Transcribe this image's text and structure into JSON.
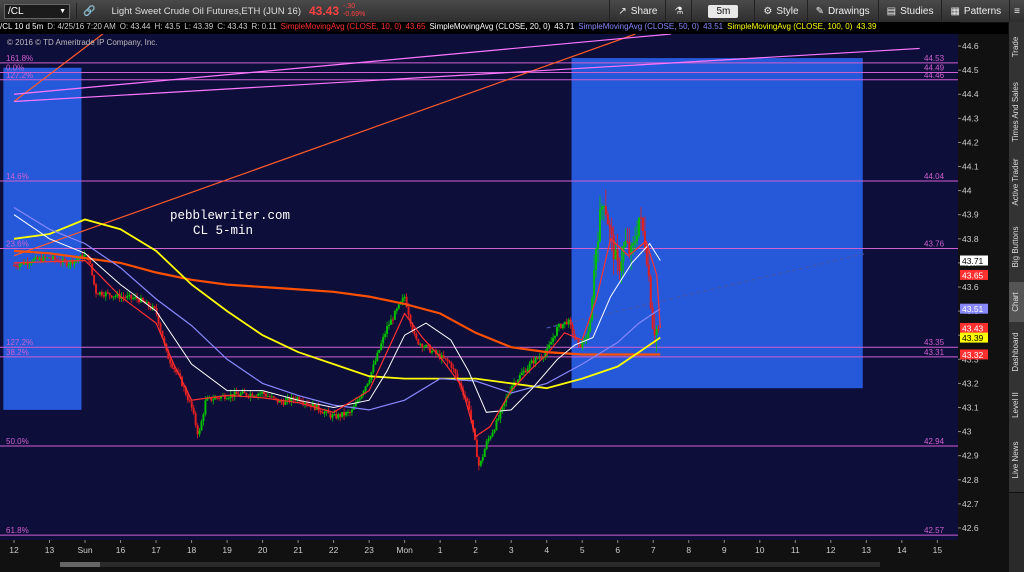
{
  "toolbar": {
    "symbol": "/CL",
    "desc": "Light Sweet Crude Oil Futures,ETH (JUN 16)",
    "last": "43.43",
    "change": "-.30",
    "change_pct": "-0.69%",
    "share": "Share",
    "timeframe": "5m",
    "style": "Style",
    "drawings": "Drawings",
    "studies": "Studies",
    "patterns": "Patterns"
  },
  "infobar": {
    "period": "/CL 10 d 5m",
    "date": "D: 4/25/16 7:20 AM",
    "open": "O: 43.44",
    "high": "H: 43.5",
    "low": "L: 43.39",
    "close": "C: 43.43",
    "range": "R: 0.11",
    "sma10_label": "SimpleMovingAvg (CLOSE, 10, 0)",
    "sma10_val": "43.65",
    "sma20_label": "SimpleMovingAvg (CLOSE, 20, 0)",
    "sma20_val": "43.71",
    "sma50_label": "SimpleMovingAvg (CLOSE, 50, 0)",
    "sma50_val": "43.51",
    "sma100_label": "SimpleMovingAvg (CLOSE, 100, 0)",
    "sma100_val": "43.39"
  },
  "copyright": "© 2016 © TD Ameritrade IP Company, Inc.",
  "annotation": {
    "line1": "pebblewriter.com",
    "line2": "CL 5-min"
  },
  "sidebar": [
    "Trade",
    "Times And Sales",
    "Active Trader",
    "Big Buttons",
    "Chart",
    "Dashboard",
    "Level II",
    "Live News"
  ],
  "colors": {
    "background": "#0e0e3a",
    "box": "#2860e8",
    "sma10": "#ff3030",
    "sma20": "#ffffff",
    "sma50": "#8888ff",
    "sma100": "#ffff00",
    "sma200": "#ff5000",
    "fib": "#d060d0",
    "up": "#00c000",
    "down": "#e02020"
  },
  "chart_data": {
    "type": "candlestick",
    "ylim": [
      42.55,
      44.65
    ],
    "y_ticks": [
      42.6,
      42.7,
      42.8,
      42.9,
      43,
      43.1,
      43.2,
      43.3,
      43.4,
      43.5,
      43.6,
      43.7,
      43.8,
      43.9,
      44,
      44.1,
      44.2,
      44.3,
      44.4,
      44.5,
      44.6
    ],
    "x_ticks": [
      "12",
      "13",
      "Sun",
      "16",
      "17",
      "18",
      "19",
      "20",
      "21",
      "22",
      "23",
      "Mon",
      "1",
      "2",
      "3",
      "4",
      "5",
      "6",
      "7",
      "8",
      "9",
      "10",
      "11",
      "12",
      "13",
      "14",
      "15"
    ],
    "x_range": [
      0,
      26.3
    ],
    "fib_levels": [
      {
        "pct": "161.8%",
        "price": "44.53",
        "value": 44.53
      },
      {
        "pct": "0.0%",
        "price": "44.49",
        "value": 44.49
      },
      {
        "pct": "127.2%",
        "price": "44.46",
        "value": 44.46
      },
      {
        "pct": "14.6%",
        "price": "44.04",
        "value": 44.04
      },
      {
        "pct": "23.6%",
        "price": "43.76",
        "value": 43.76
      },
      {
        "pct": "127.2%",
        "price": "43.35",
        "value": 43.35
      },
      {
        "pct": "38.2%",
        "price": "43.31",
        "value": 43.31
      },
      {
        "pct": "50.0%",
        "price": "42.94",
        "value": 42.94
      },
      {
        "pct": "61.8%",
        "price": "42.57",
        "value": 42.57
      }
    ],
    "price_tags": [
      {
        "label": "43.71",
        "value": 43.71,
        "color": "#ffffff",
        "text": "#000000"
      },
      {
        "label": "43.65",
        "value": 43.65,
        "color": "#ff3030",
        "text": "#ffffff"
      },
      {
        "label": "43.51",
        "value": 43.51,
        "color": "#8888ff",
        "text": "#ffffff"
      },
      {
        "label": "43.43",
        "value": 43.43,
        "color": "#ff3030",
        "text": "#ffffff"
      },
      {
        "label": "43.39",
        "value": 43.39,
        "color": "#ffff00",
        "text": "#000000"
      },
      {
        "label": "43.32",
        "value": 43.32,
        "color": "#ff3030",
        "text": "#ffffff"
      }
    ],
    "boxes": [
      {
        "x0": -0.3,
        "x1": 1.9,
        "y0": 43.09,
        "y1": 44.51
      },
      {
        "x0": 15.7,
        "x1": 23.9,
        "y0": 43.18,
        "y1": 44.55
      }
    ],
    "trendlines": [
      {
        "name": "red",
        "color": "#ff5a2a",
        "p0": [
          0,
          43.73
        ],
        "p1": [
          17.5,
          44.65
        ]
      },
      {
        "name": "red-upper",
        "color": "#ff5a2a",
        "p0": [
          0,
          44.37
        ],
        "p1": [
          2.5,
          44.65
        ]
      },
      {
        "name": "pink-1",
        "color": "#ff77ff",
        "p0": [
          0,
          44.37
        ],
        "p1": [
          25.5,
          44.59
        ]
      },
      {
        "name": "pink-2",
        "color": "#ff77ff",
        "p0": [
          0,
          44.4
        ],
        "p1": [
          18.5,
          44.65
        ]
      },
      {
        "name": "dashed",
        "color": "#4455aa",
        "p0": [
          15.0,
          43.43
        ],
        "p1": [
          24.0,
          43.74
        ]
      }
    ],
    "price_path": [
      [
        0,
        43.69
      ],
      [
        0.5,
        43.71
      ],
      [
        1.0,
        43.72
      ],
      [
        1.5,
        43.7
      ],
      [
        2.0,
        43.73
      ],
      [
        2.1,
        43.72
      ],
      [
        2.3,
        43.58
      ],
      [
        3.0,
        43.56
      ],
      [
        3.5,
        43.55
      ],
      [
        4.0,
        43.5
      ],
      [
        4.3,
        43.32
      ],
      [
        4.7,
        43.21
      ],
      [
        5.0,
        43.1
      ],
      [
        5.2,
        42.98
      ],
      [
        5.4,
        43.13
      ],
      [
        6.0,
        43.15
      ],
      [
        7.0,
        43.16
      ],
      [
        7.5,
        43.12
      ],
      [
        8.0,
        43.14
      ],
      [
        8.5,
        43.1
      ],
      [
        9.0,
        43.06
      ],
      [
        9.5,
        43.08
      ],
      [
        10.0,
        43.22
      ],
      [
        10.5,
        43.43
      ],
      [
        11.0,
        43.56
      ],
      [
        11.3,
        43.38
      ],
      [
        11.8,
        43.33
      ],
      [
        12.3,
        43.28
      ],
      [
        12.8,
        43.11
      ],
      [
        13.1,
        42.85
      ],
      [
        13.3,
        42.95
      ],
      [
        13.6,
        43.04
      ],
      [
        14.0,
        43.19
      ],
      [
        14.6,
        43.29
      ],
      [
        15.0,
        43.33
      ],
      [
        15.3,
        43.43
      ],
      [
        15.6,
        43.46
      ],
      [
        15.9,
        43.35
      ],
      [
        16.2,
        43.41
      ],
      [
        16.4,
        43.79
      ],
      [
        16.6,
        43.98
      ],
      [
        16.8,
        43.81
      ],
      [
        17.0,
        43.67
      ],
      [
        17.2,
        43.78
      ],
      [
        17.4,
        43.73
      ],
      [
        17.6,
        43.89
      ],
      [
        17.8,
        43.77
      ],
      [
        18.0,
        43.43
      ],
      [
        18.2,
        43.42
      ]
    ],
    "sma_paths": {
      "sma10": [
        [
          0,
          43.7
        ],
        [
          2,
          43.71
        ],
        [
          3,
          43.56
        ],
        [
          4,
          43.45
        ],
        [
          4.5,
          43.28
        ],
        [
          5,
          43.13
        ],
        [
          6,
          43.15
        ],
        [
          7,
          43.14
        ],
        [
          8,
          43.12
        ],
        [
          9,
          43.08
        ],
        [
          10,
          43.17
        ],
        [
          10.5,
          43.33
        ],
        [
          11,
          43.49
        ],
        [
          11.5,
          43.39
        ],
        [
          12,
          43.31
        ],
        [
          12.6,
          43.19
        ],
        [
          13,
          42.98
        ],
        [
          13.4,
          43.02
        ],
        [
          14,
          43.17
        ],
        [
          14.5,
          43.25
        ],
        [
          15,
          43.32
        ],
        [
          15.5,
          43.41
        ],
        [
          16,
          43.38
        ],
        [
          16.4,
          43.55
        ],
        [
          16.8,
          43.8
        ],
        [
          17.3,
          43.73
        ],
        [
          17.8,
          43.79
        ],
        [
          18.1,
          43.65
        ],
        [
          18.2,
          43.43
        ]
      ],
      "sma20": [
        [
          0,
          43.9
        ],
        [
          1,
          43.8
        ],
        [
          2,
          43.74
        ],
        [
          3,
          43.61
        ],
        [
          4,
          43.5
        ],
        [
          5,
          43.28
        ],
        [
          6,
          43.17
        ],
        [
          7,
          43.17
        ],
        [
          8,
          43.13
        ],
        [
          9,
          43.1
        ],
        [
          10,
          43.13
        ],
        [
          10.5,
          43.25
        ],
        [
          11,
          43.4
        ],
        [
          11.6,
          43.45
        ],
        [
          12.3,
          43.38
        ],
        [
          12.8,
          43.25
        ],
        [
          13.3,
          43.08
        ],
        [
          14,
          43.09
        ],
        [
          14.6,
          43.18
        ],
        [
          15.3,
          43.3
        ],
        [
          15.8,
          43.36
        ],
        [
          16.3,
          43.39
        ],
        [
          16.8,
          43.56
        ],
        [
          17.4,
          43.7
        ],
        [
          17.9,
          43.78
        ],
        [
          18.2,
          43.71
        ]
      ],
      "sma50": [
        [
          0,
          43.93
        ],
        [
          1,
          43.84
        ],
        [
          2,
          43.78
        ],
        [
          3,
          43.68
        ],
        [
          4,
          43.55
        ],
        [
          5,
          43.44
        ],
        [
          6,
          43.3
        ],
        [
          7,
          43.2
        ],
        [
          8,
          43.15
        ],
        [
          9,
          43.11
        ],
        [
          10,
          43.09
        ],
        [
          11,
          43.13
        ],
        [
          12,
          43.22
        ],
        [
          13,
          43.21
        ],
        [
          14,
          43.16
        ],
        [
          15,
          43.2
        ],
        [
          16,
          43.28
        ],
        [
          17,
          43.37
        ],
        [
          17.6,
          43.45
        ],
        [
          18.2,
          43.51
        ]
      ],
      "sma100": [
        [
          0,
          43.8
        ],
        [
          1,
          43.82
        ],
        [
          2,
          43.88
        ],
        [
          3,
          43.84
        ],
        [
          4,
          43.75
        ],
        [
          5,
          43.61
        ],
        [
          6,
          43.5
        ],
        [
          7,
          43.4
        ],
        [
          8,
          43.33
        ],
        [
          9,
          43.28
        ],
        [
          10,
          43.23
        ],
        [
          11,
          43.22
        ],
        [
          12,
          43.22
        ],
        [
          13,
          43.22
        ],
        [
          14,
          43.2
        ],
        [
          15,
          43.18
        ],
        [
          16,
          43.22
        ],
        [
          17,
          43.27
        ],
        [
          17.6,
          43.33
        ],
        [
          18.2,
          43.39
        ]
      ],
      "sma200": [
        [
          0,
          43.75
        ],
        [
          1,
          43.74
        ],
        [
          2,
          43.72
        ],
        [
          3,
          43.7
        ],
        [
          4,
          43.66
        ],
        [
          5,
          43.63
        ],
        [
          6,
          43.61
        ],
        [
          7,
          43.6
        ],
        [
          8,
          43.59
        ],
        [
          9,
          43.58
        ],
        [
          10,
          43.56
        ],
        [
          11,
          43.53
        ],
        [
          12,
          43.49
        ],
        [
          13,
          43.41
        ],
        [
          14,
          43.35
        ],
        [
          15,
          43.33
        ],
        [
          16,
          43.32
        ],
        [
          17,
          43.32
        ],
        [
          18,
          43.32
        ],
        [
          18.2,
          43.32
        ]
      ]
    }
  }
}
